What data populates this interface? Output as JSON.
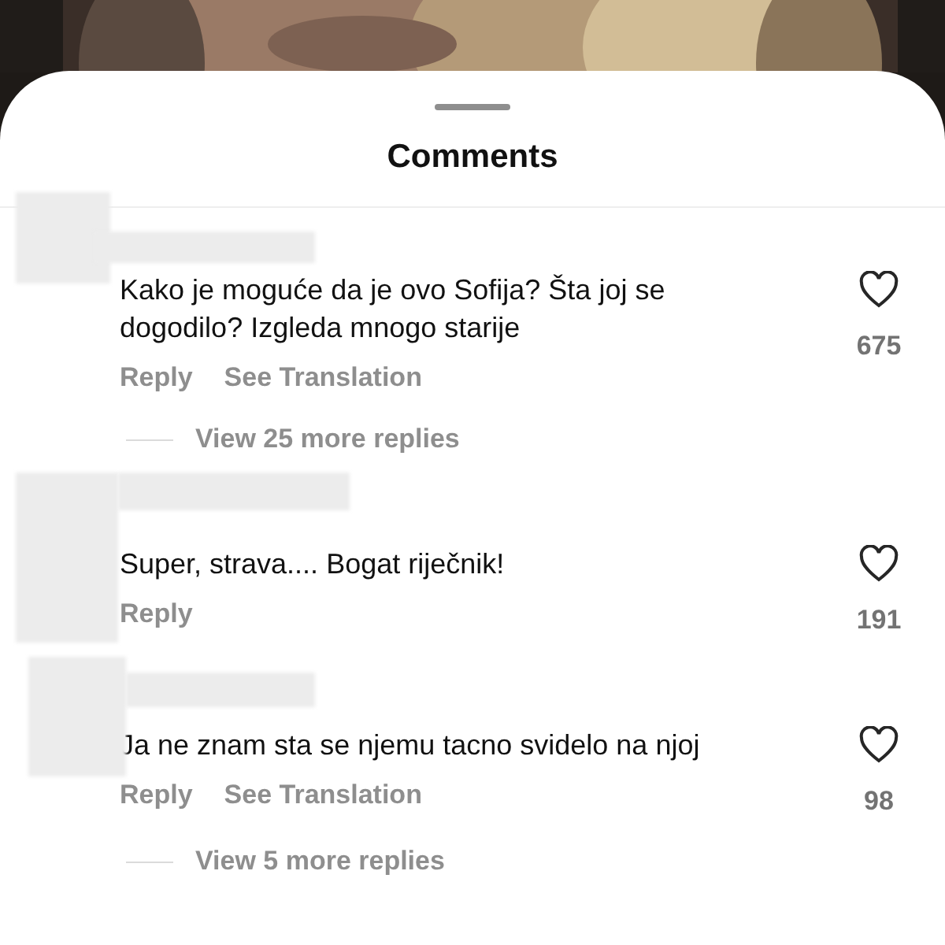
{
  "sheet": {
    "title": "Comments"
  },
  "comments": [
    {
      "text": "Kako je moguće da je ovo Sofija? Šta joj se dogodilo? Izgleda mnogo starije",
      "actions": [
        "Reply",
        "See Translation"
      ],
      "liked": false,
      "likes": "675",
      "more_replies": "View 25 more replies"
    },
    {
      "text": "Super, strava.... Bogat riječnik!",
      "actions": [
        "Reply"
      ],
      "liked": false,
      "likes": "191"
    },
    {
      "text": "Ja ne znam sta se njemu tacno svidelo na njoj",
      "actions": [
        "Reply",
        "See Translation"
      ],
      "liked": false,
      "likes": "98",
      "more_replies": "View 5 more replies"
    }
  ]
}
